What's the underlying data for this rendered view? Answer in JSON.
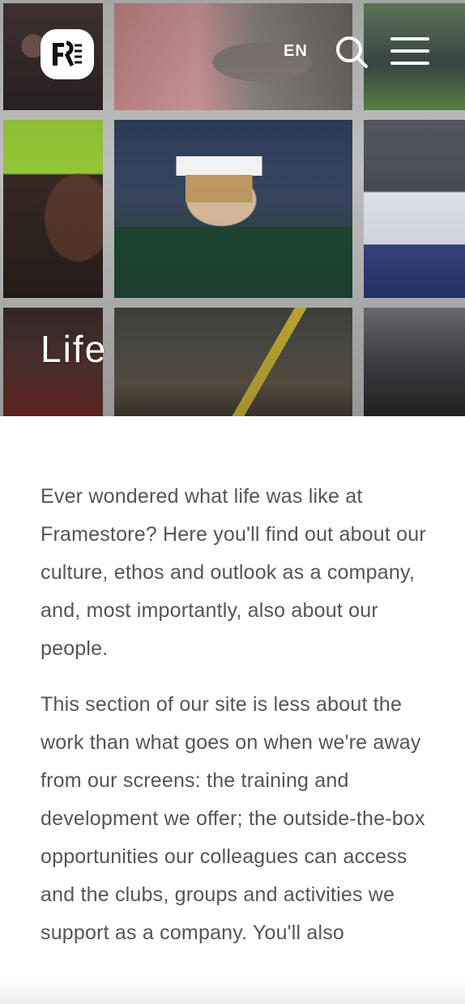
{
  "header": {
    "language": "EN",
    "logo_icon": "framestore-logo-icon",
    "search_icon": "search-icon",
    "menu_icon": "hamburger-menu-icon"
  },
  "hero": {
    "title": "Life"
  },
  "intro": {
    "paragraphs": [
      "Ever wondered what life was like at Framestore? Here you'll find out about our culture, ethos and outlook as a company, and, most importantly, also about our people.",
      "This section of our site is less about the work than what goes on when we're away from our screens: the training and development we offer; the outside-the-box opportunities our colleagues can access and the clubs, groups and activities we support as a company.  You'll also"
    ]
  },
  "colors": {
    "hero_text": "#ffffff",
    "body_text": "#555555",
    "grid_gap": "#c9c9c9"
  }
}
